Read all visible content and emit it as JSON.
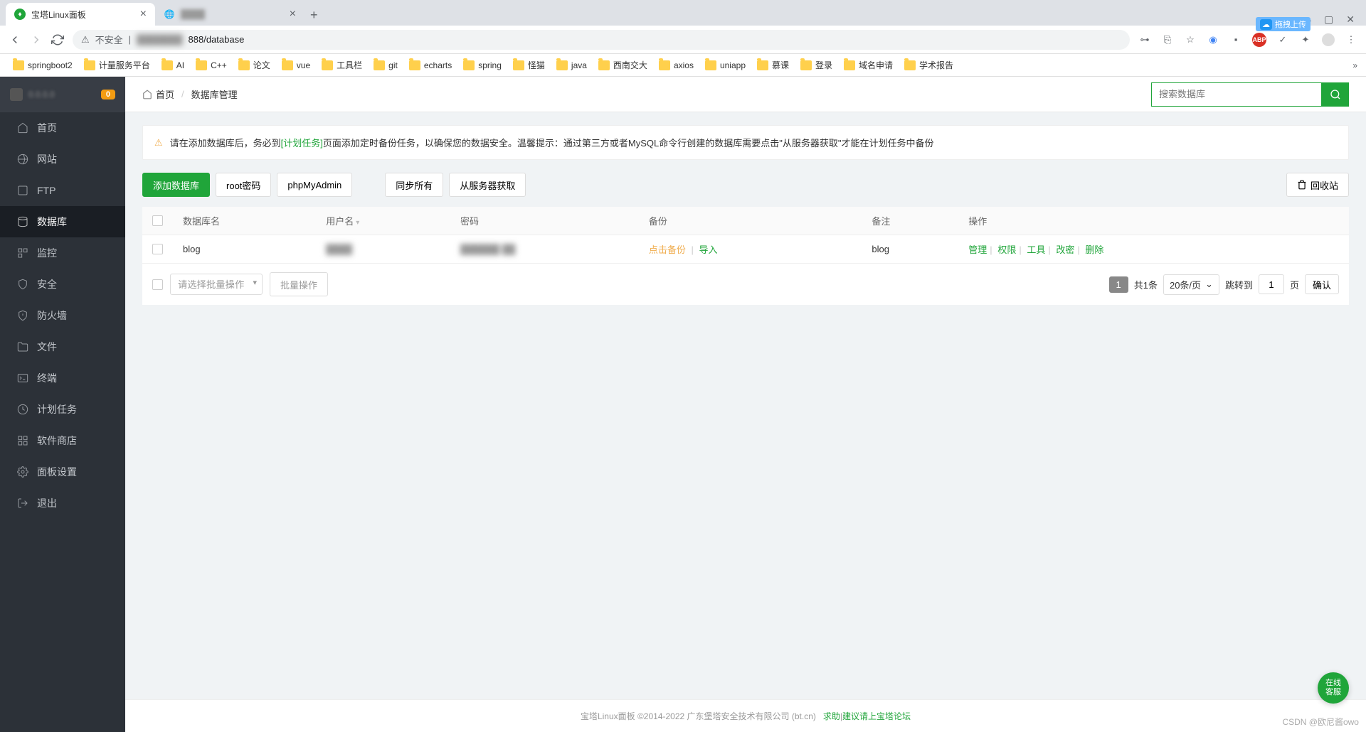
{
  "browser": {
    "tabs": [
      {
        "title": "宝塔Linux面板",
        "icon": "bt"
      },
      {
        "title": "",
        "icon": "globe"
      }
    ],
    "address": {
      "insecure_label": "不安全",
      "url_suffix": "888/database"
    },
    "upload_widget": "拖拽上传",
    "bookmarks": [
      "springboot2",
      "计量服务平台",
      "AI",
      "C++",
      "论文",
      "vue",
      "工具栏",
      "git",
      "echarts",
      "spring",
      "怪猫",
      "java",
      "西南交大",
      "axios",
      "uniapp",
      "慕课",
      "登录",
      "域名申请",
      "学术报告"
    ]
  },
  "sidebar": {
    "host_blur": "0.0.0.0",
    "msg_count": "0",
    "items": [
      {
        "icon": "home",
        "label": "首页"
      },
      {
        "icon": "globe",
        "label": "网站"
      },
      {
        "icon": "ftp",
        "label": "FTP"
      },
      {
        "icon": "database",
        "label": "数据库",
        "active": true
      },
      {
        "icon": "monitor",
        "label": "监控"
      },
      {
        "icon": "shield",
        "label": "安全"
      },
      {
        "icon": "firewall",
        "label": "防火墙"
      },
      {
        "icon": "folder",
        "label": "文件"
      },
      {
        "icon": "terminal",
        "label": "终端"
      },
      {
        "icon": "clock",
        "label": "计划任务"
      },
      {
        "icon": "grid",
        "label": "软件商店"
      },
      {
        "icon": "gear",
        "label": "面板设置"
      },
      {
        "icon": "exit",
        "label": "退出"
      }
    ]
  },
  "breadcrumb": {
    "home": "首页",
    "current": "数据库管理"
  },
  "search": {
    "placeholder": "搜索数据库"
  },
  "alert": {
    "pre": "请在添加数据库后，务必到",
    "highlight": "[计划任务]",
    "post": "页面添加定时备份任务，以确保您的数据安全。温馨提示：通过第三方或者MySQL命令行创建的数据库需要点击\"从服务器获取\"才能在计划任务中备份"
  },
  "toolbar": {
    "add": "添加数据库",
    "root_pwd": "root密码",
    "phpmyadmin": "phpMyAdmin",
    "sync_all": "同步所有",
    "from_server": "从服务器获取",
    "recycle": "回收站"
  },
  "table": {
    "headers": {
      "name": "数据库名",
      "user": "用户名",
      "password": "密码",
      "backup": "备份",
      "note": "备注",
      "action": "操作"
    },
    "rows": [
      {
        "name": "blog",
        "user_blur": "████",
        "pwd_blur": "██████ ██",
        "backup_click": "点击备份",
        "backup_import": "导入",
        "note": "blog",
        "actions": [
          "管理",
          "权限",
          "工具",
          "改密",
          "删除"
        ]
      }
    ]
  },
  "batch": {
    "select_placeholder": "请选择批量操作",
    "exec": "批量操作"
  },
  "pagination": {
    "page": "1",
    "total": "共1条",
    "page_size": "20条/页",
    "jump_label": "跳转到",
    "page_unit": "页",
    "confirm": "确认",
    "jump_value": "1"
  },
  "footer": {
    "copyright": "宝塔Linux面板 ©2014-2022 广东堡塔安全技术有限公司 (bt.cn)",
    "help": "求助",
    "sep": "|",
    "forum": "建议请上宝塔论坛"
  },
  "float_service": "在线\n客服",
  "watermark": "CSDN @欧尼酱owo"
}
